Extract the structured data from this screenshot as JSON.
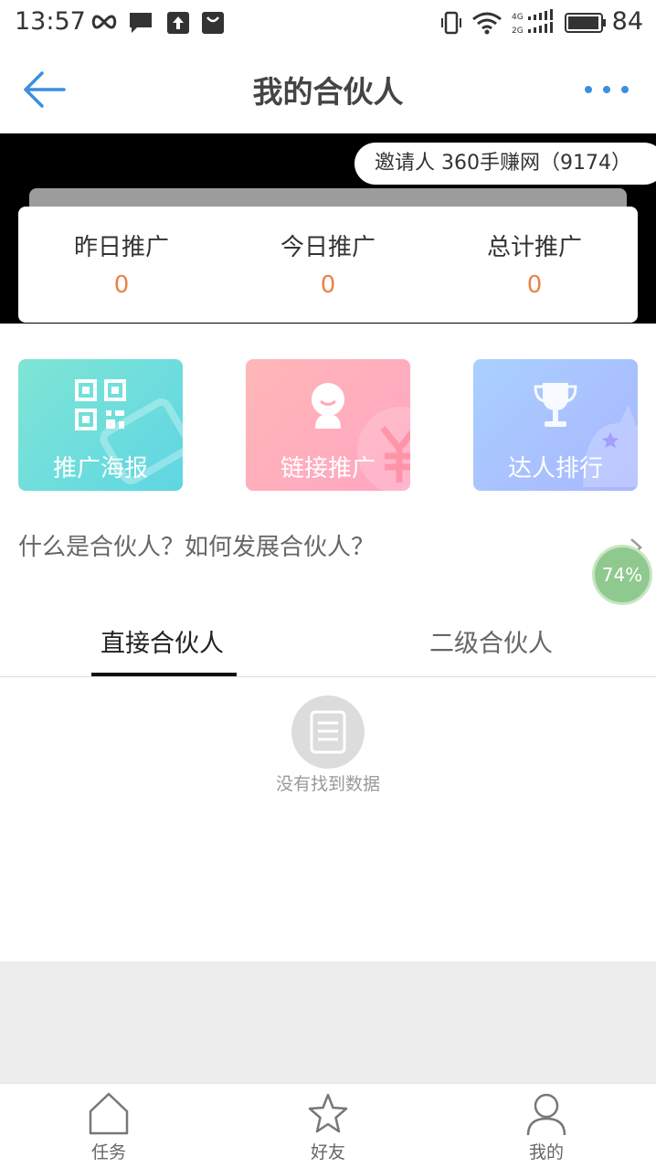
{
  "status_bar": {
    "time": "13:57",
    "battery": "84",
    "network_top": "4G",
    "network_bottom": "2G"
  },
  "nav": {
    "title": "我的合伙人"
  },
  "inviter": {
    "text": "邀请人 360手赚网（9174）"
  },
  "stats": [
    {
      "label": "昨日推广",
      "value": "0"
    },
    {
      "label": "今日推广",
      "value": "0"
    },
    {
      "label": "总计推广",
      "value": "0"
    }
  ],
  "tiles": [
    {
      "label": "推广海报",
      "icon": "qr-code-icon"
    },
    {
      "label": "链接推广",
      "icon": "smiley-person-icon"
    },
    {
      "label": "达人排行",
      "icon": "trophy-icon"
    }
  ],
  "question": "什么是合伙人？如何发展合伙人？",
  "floating_badge": "74%",
  "tabs": [
    {
      "label": "直接合伙人",
      "active": true
    },
    {
      "label": "二级合伙人",
      "active": false
    }
  ],
  "empty_state": {
    "text": "没有找到数据"
  },
  "bottom_nav": [
    {
      "label": "任务",
      "icon": "home-icon"
    },
    {
      "label": "好友",
      "icon": "star-icon"
    },
    {
      "label": "我的",
      "icon": "person-icon"
    }
  ],
  "colors": {
    "accent_blue": "#3a8fe0",
    "stat_value": "#e8834a",
    "tab_active": "#111111"
  }
}
